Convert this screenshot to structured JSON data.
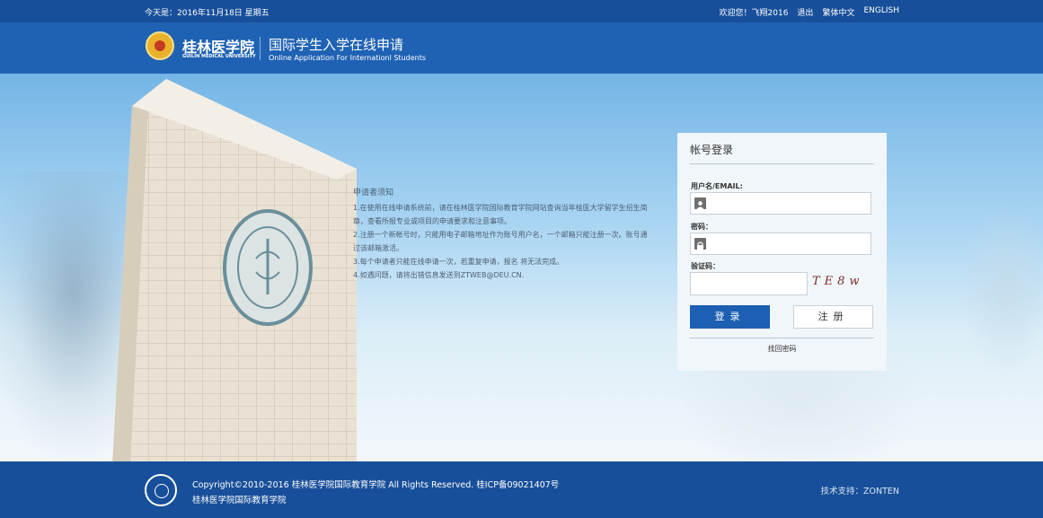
{
  "topbar": {
    "date": "今天是：2016年11月18日  星期五",
    "welcome": "欢迎您！飞翔2016",
    "logout": "退出",
    "traditional": "繁体中文",
    "english": "ENGLISH"
  },
  "header": {
    "school_name_cn": "桂林医学院",
    "school_name_en": "GUILIN MEDICAL UNIVERSITY",
    "title_cn": "国际学生入学在线申请",
    "title_en": "Online Application For Internationl Students"
  },
  "notice": {
    "title": "申请者须知",
    "items": [
      "1.在使用在线申请系统前，请在桂林医学院国际教育学院网站查询当年桂医大学留学生招生简章，查看所报专业或项目的申请要求和注意事项。",
      "2.注册一个新帐号时，只能用电子邮箱地址作为账号用户名，一个邮箱只能注册一次。账号通过该邮箱激活。",
      "3.每个申请者只能在线申请一次，若重复申请，报名 将无法完成。",
      "4.如遇问题，请将出错信息发送到ZTWEB@DEU.CN."
    ]
  },
  "login": {
    "title": "帐号登录",
    "username_label": "用户名/EMAIL:",
    "username_value": "",
    "password_label": "密码：",
    "password_value": "",
    "captcha_label": "验证码：",
    "captcha_value": "",
    "captcha_image_text": "TE8w",
    "login_button": "登录",
    "register_button": "注册",
    "forgot_link": "找回密码"
  },
  "footer": {
    "copyright": "Copyright©2010-2016 桂林医学院国际教育学院 All Rights Reserved.  桂ICP备09021407号",
    "school": "桂林医学院国际教育学院",
    "tech_support": "技术支持：ZONTEN"
  },
  "colors": {
    "primary": "#1d5fb2",
    "topbar": "#184f9a",
    "header": "#1f62b4"
  }
}
